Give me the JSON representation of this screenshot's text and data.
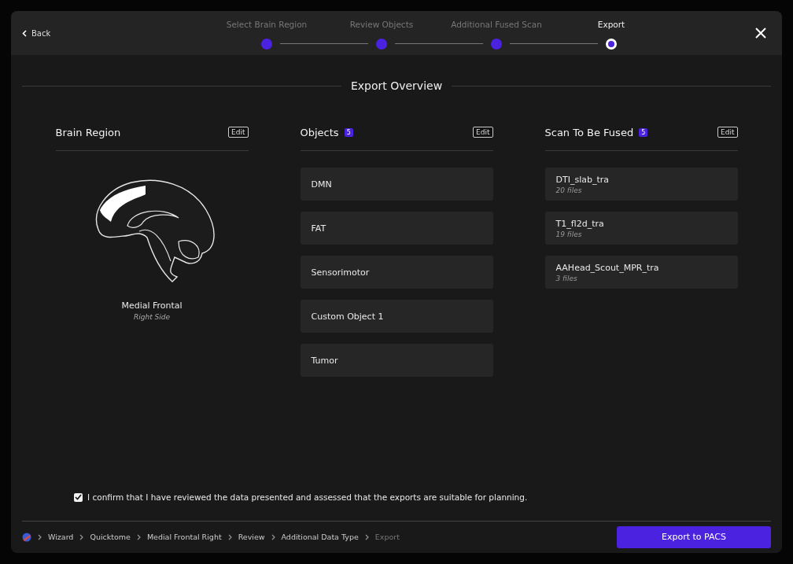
{
  "header": {
    "back": "Back",
    "steps": [
      {
        "label": "Select Brain Region",
        "selected": false
      },
      {
        "label": "Review Objects",
        "selected": false
      },
      {
        "label": "Additional Fused Scan",
        "selected": false
      },
      {
        "label": "Export",
        "selected": true
      }
    ]
  },
  "title": "Export Overview",
  "brain_region": {
    "heading": "Brain Region",
    "edit": "Edit",
    "region": "Medial Frontal",
    "side": "Right Side"
  },
  "objects": {
    "heading": "Objects",
    "count": "5",
    "edit": "Edit",
    "items": [
      "DMN",
      "FAT",
      "Sensorimotor",
      "Custom Object 1",
      "Tumor"
    ]
  },
  "scans": {
    "heading": "Scan To Be Fused",
    "count": "5",
    "edit": "Edit",
    "items": [
      {
        "name": "DTI_slab_tra",
        "files": "20 files"
      },
      {
        "name": "T1_fl2d_tra",
        "files": "19 files"
      },
      {
        "name": "AAHead_Scout_MPR_tra",
        "files": "3 files"
      }
    ]
  },
  "confirm": {
    "checked": true,
    "label": "I confirm that I have reviewed the data presented and assessed that the exports are suitable for planning."
  },
  "breadcrumb": [
    "Wizard",
    "Quicktome",
    "Medial Frontal Right",
    "Review",
    "Additional Data Type",
    "Export"
  ],
  "export_button": "Export to PACS"
}
